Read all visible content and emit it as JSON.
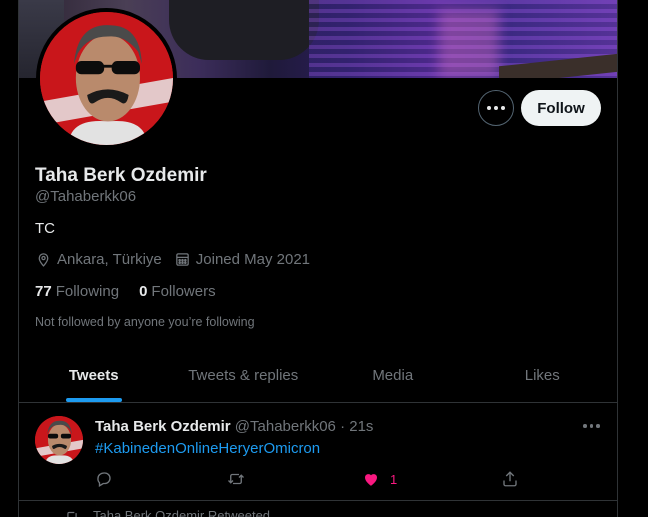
{
  "profile": {
    "name": "Taha Berk Ozdemir",
    "handle": "@Tahaberkk06",
    "bio": "TC",
    "location": "Ankara, Türkiye",
    "joined": "Joined May 2021",
    "following_count": "77",
    "following_label": "Following",
    "followers_count": "0",
    "followers_label": "Followers",
    "not_followed_text": "Not followed by anyone you’re following"
  },
  "buttons": {
    "follow_label": "Follow",
    "more_icon": "more-horizontal-icon"
  },
  "tabs": [
    {
      "label": "Tweets",
      "active": true
    },
    {
      "label": "Tweets & replies",
      "active": false
    },
    {
      "label": "Media",
      "active": false
    },
    {
      "label": "Likes",
      "active": false
    }
  ],
  "tweet": {
    "author_name": "Taha Berk Ozdemir",
    "author_meta": "@Tahaberkk06 · 21s",
    "hashtag": "#KabinedenOnlineHeryerOmicron",
    "like_count": "1"
  },
  "next_item": {
    "retweeted_text": "Taha Berk Ozdemir Retweeted"
  },
  "colors": {
    "accent": "#1d9bf0",
    "like": "#f91880",
    "text": "#e7e9ea",
    "muted": "#71767b",
    "border": "#2f3336"
  }
}
